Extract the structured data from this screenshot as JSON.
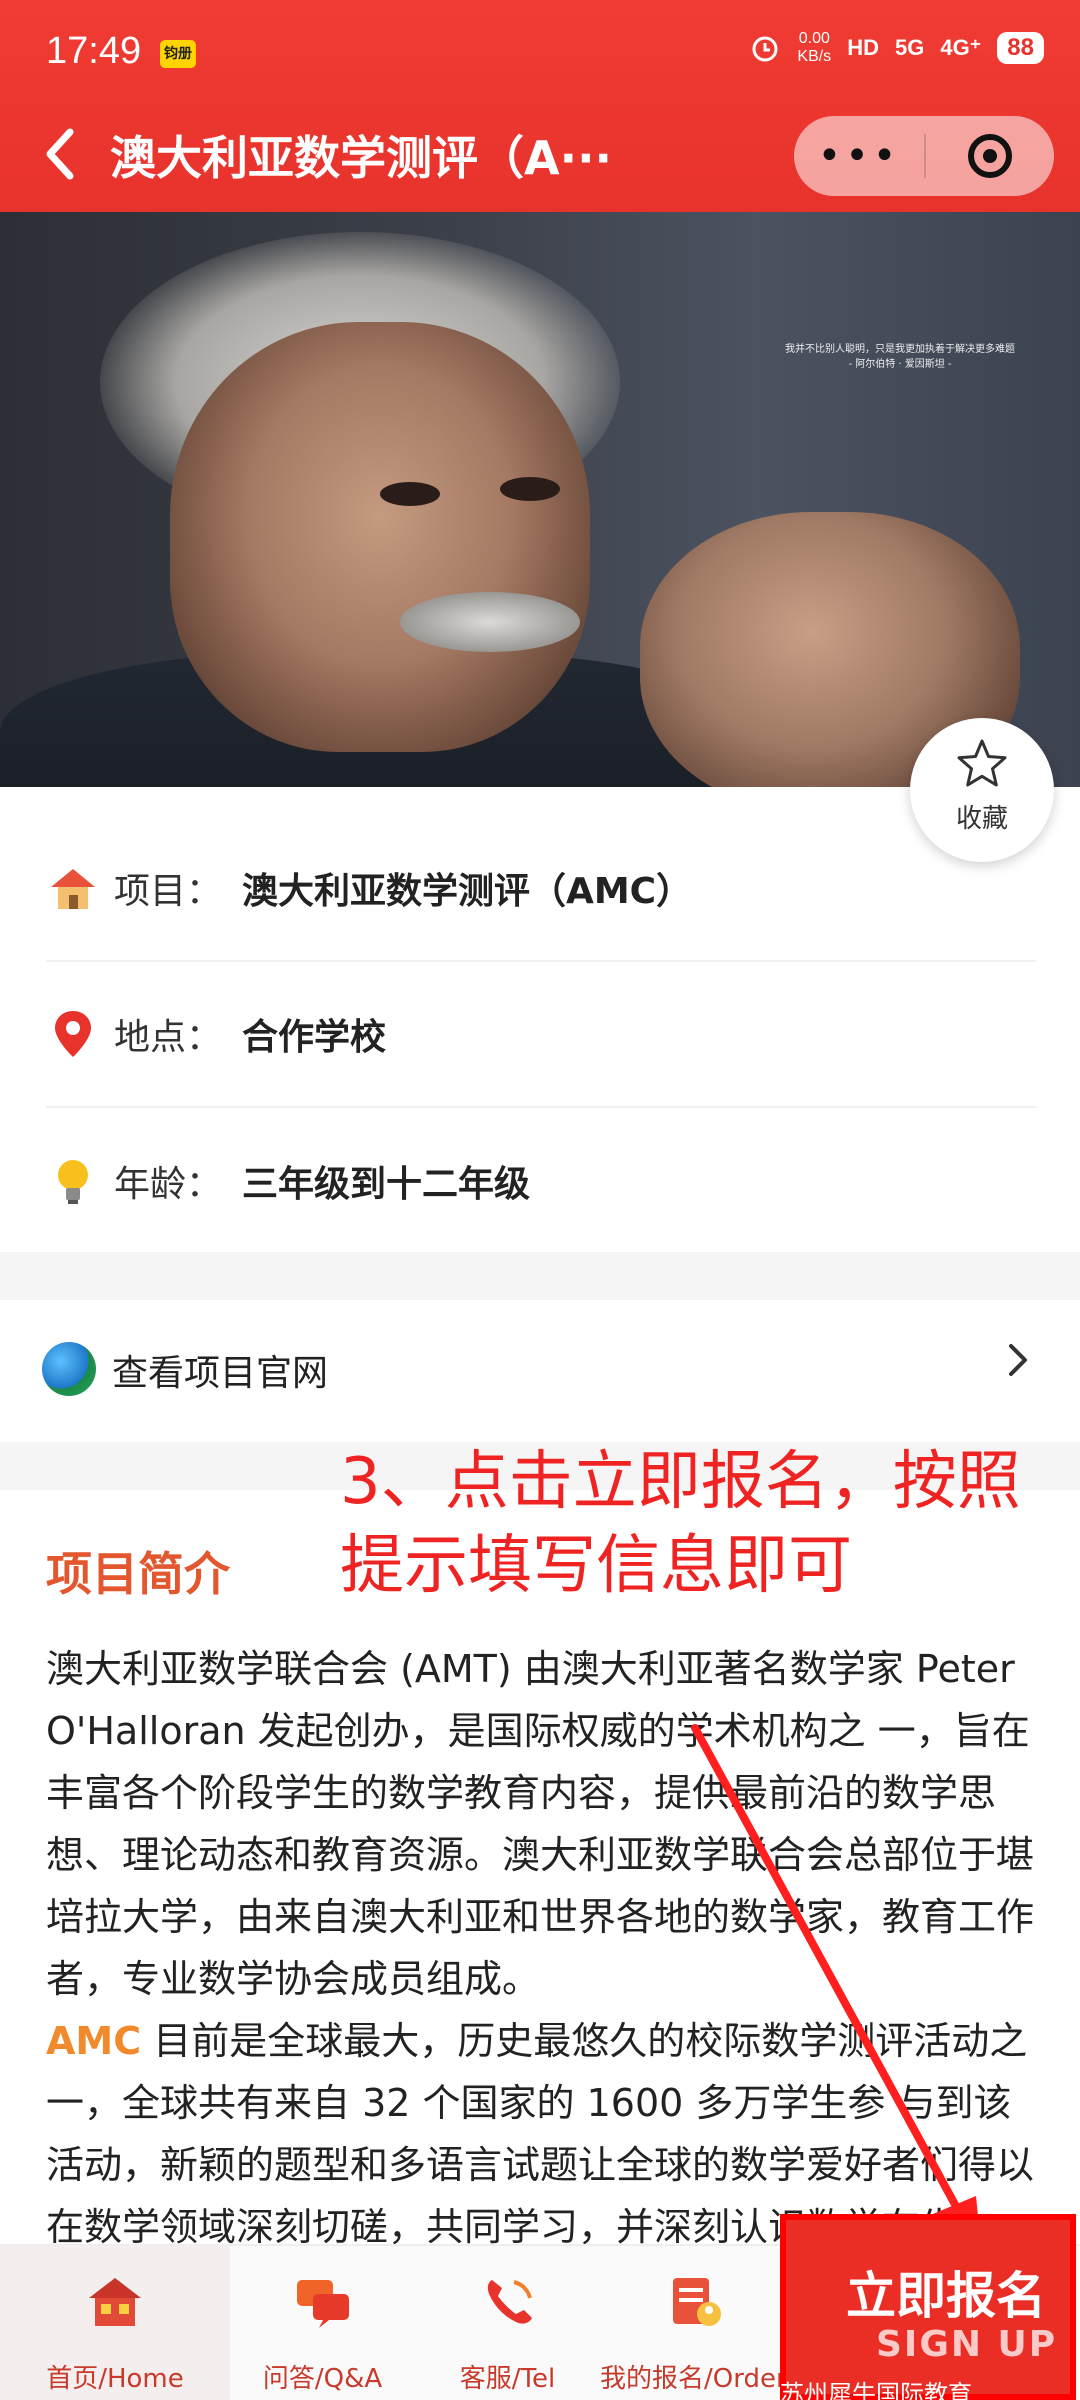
{
  "status_bar": {
    "time": "17:49",
    "app_badge": "钧册",
    "net_speed_top": "0.00",
    "net_speed_bottom": "KB/s",
    "network": "5G",
    "network2": "4G⁺",
    "battery": "88"
  },
  "header": {
    "back_icon": "chevron-left-icon",
    "title": "澳大利亚数学测评（A···",
    "capsule_more": "•••"
  },
  "banner": {
    "quote_line1": "我并不比别人聪明，只是我更加执着于解决更多难题",
    "quote_line2": "- 阿尔伯特 · 爱因斯坦 -"
  },
  "favorite": {
    "label": "收藏"
  },
  "info": {
    "project": {
      "label": "项目：",
      "value": "澳大利亚数学测评（AMC）"
    },
    "location": {
      "label": "地点：",
      "value": "合作学校"
    },
    "age": {
      "label": "年龄：",
      "value": "三年级到十二年级"
    }
  },
  "website": {
    "label": "查看项目官网"
  },
  "annotation": {
    "text": "3、点击立即报名，按照提示填写信息即可"
  },
  "intro": {
    "title": "项目简介",
    "para1": "澳大利亚数学联合会 (AMT) 由澳大利亚著名数学家 Peter O'Halloran 发起创办，是国际权威的学术机构之 一，旨在丰富各个阶段学生的数学教育内容，提供最前沿的数学思想、理论动态和教育资源。澳大利亚数学联合会总部位于堪培拉大学，由来自澳大利亚和世界各地的数学家，教育工作者，专业数学协会成员组成。",
    "para2_highlight": "AMC",
    "para2": " 目前是全球最大，历史最悠久的校际数学测评活动之一，全球共有来自 32 个国家的 1600 多万学生参 与到该活动，新颖的题型和多语言试题让全球的数学爱好者们得以在数学领域深刻切磋，共同学习，并深刻认识数学在生"
  },
  "tabbar": {
    "home": "首页/Home",
    "qa": "问答/Q&A",
    "tel": "客服/Tel",
    "orders": "我的报名/Orders",
    "signup_main": "立即报名",
    "signup_sub": "SIGN UP",
    "watermark": "苏州犀牛国际教育"
  },
  "colors": {
    "header_red": "#e8322c",
    "accent_orange": "#e2572e",
    "annotation_red": "#f02323"
  }
}
